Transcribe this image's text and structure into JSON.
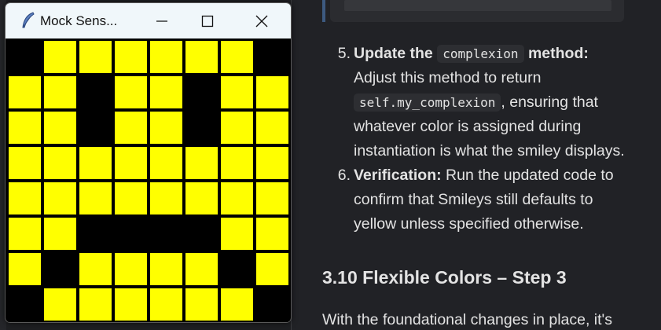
{
  "window": {
    "title": "Mock Sens...",
    "min_glyph": "—",
    "close_glyph": "✕"
  },
  "colors": {
    "on": "#ffff00",
    "off": "#000000"
  },
  "grid": [
    [
      0,
      1,
      1,
      1,
      1,
      1,
      1,
      0
    ],
    [
      1,
      1,
      0,
      1,
      1,
      0,
      1,
      1
    ],
    [
      1,
      1,
      0,
      1,
      1,
      0,
      1,
      1
    ],
    [
      1,
      1,
      1,
      1,
      1,
      1,
      1,
      1
    ],
    [
      1,
      1,
      1,
      1,
      1,
      1,
      1,
      1
    ],
    [
      1,
      1,
      0,
      0,
      0,
      0,
      1,
      1
    ],
    [
      1,
      0,
      1,
      1,
      1,
      1,
      0,
      1
    ],
    [
      0,
      1,
      1,
      1,
      1,
      1,
      1,
      0
    ]
  ],
  "doc": {
    "item5": {
      "num": "5.",
      "bold1": "Update the",
      "code1": "complexion",
      "bold2": "method:",
      "line2": "Adjust this method to return",
      "code2": "self.my_complexion",
      "line3_tail": ", ensuring that",
      "line4": "whatever color is assigned during",
      "line5": "instantiation is what the smiley displays."
    },
    "item6": {
      "num": "6.",
      "bold": "Verification:",
      "line1_tail": " Run the updated code to",
      "line2": "confirm that Smileys still defaults to",
      "line3": "yellow unless specified otherwise."
    },
    "heading": "3.10 Flexible Colors – Step 3",
    "para": "With the foundational changes in place, it's"
  }
}
